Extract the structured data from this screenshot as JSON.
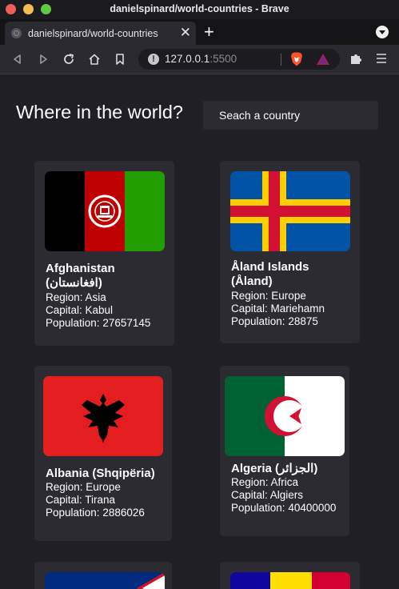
{
  "window": {
    "title": "danielspinard/world-countries - Brave"
  },
  "tab": {
    "title": "danielspinard/world-countries",
    "close": "✕"
  },
  "newtab": "+",
  "urlbar": {
    "host": "127.0.0.1",
    "port": ":5500"
  },
  "page": {
    "title": "Where in the world?",
    "search_placeholder": "Seach a country",
    "region_prefix": "Region: ",
    "capital_prefix": "Capital: ",
    "population_prefix": "Population: "
  },
  "countries": [
    {
      "name": "Afghanistan\n(افغانستان)",
      "region": "Asia",
      "capital": "Kabul",
      "population": "27657145"
    },
    {
      "name": "Åland Islands\n(Åland)",
      "region": "Europe",
      "capital": "Mariehamn",
      "population": "28875"
    },
    {
      "name": "Albania (Shqipëria)",
      "region": "Europe",
      "capital": "Tirana",
      "population": "2886026"
    },
    {
      "name": "Algeria (الجزائر)",
      "region": "Africa",
      "capital": "Algiers",
      "population": "40400000"
    }
  ],
  "colors": {
    "background": "#1f1f25",
    "card": "#2b2b31",
    "text": "#ffffff"
  }
}
